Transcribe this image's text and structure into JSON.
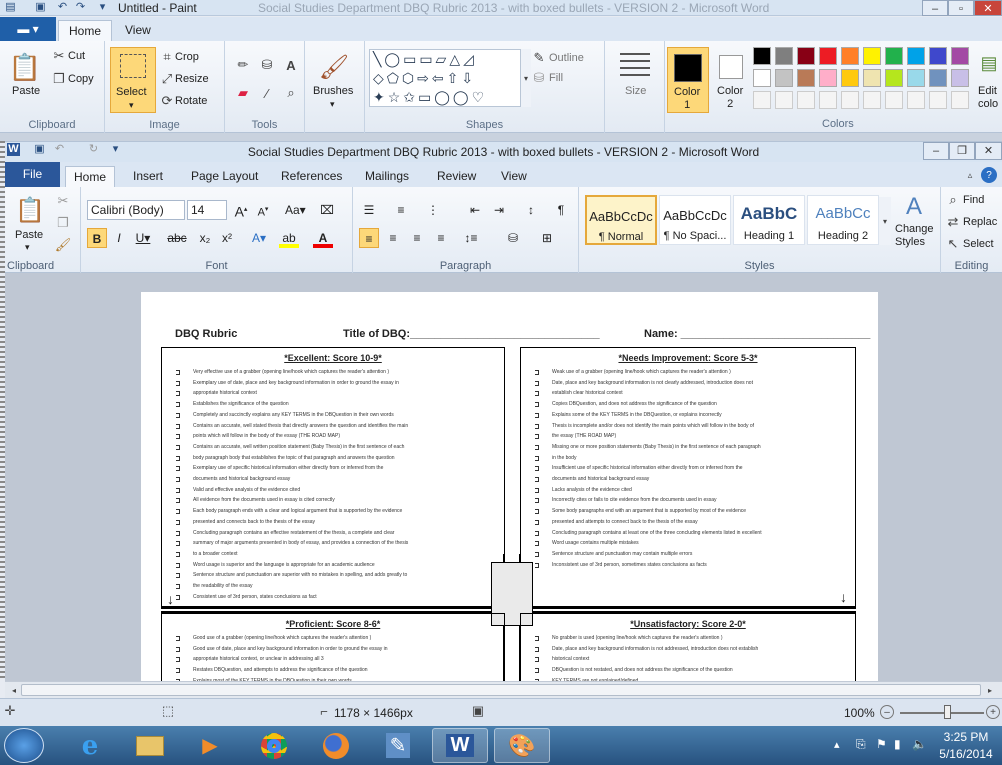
{
  "paint": {
    "title": "Untitled - Paint",
    "ghost_title": "Social Studies Department DBQ Rubric 2013 - with boxed bullets - VERSION 2 - Microsoft Word",
    "tabs": [
      "Home",
      "View"
    ],
    "clipboard": {
      "paste": "Paste",
      "cut": "Cut",
      "copy": "Copy",
      "label": "Clipboard"
    },
    "image": {
      "select": "Select",
      "crop": "Crop",
      "resize": "Resize",
      "rotate": "Rotate",
      "label": "Image"
    },
    "tools_label": "Tools",
    "brushes": "Brushes",
    "shapes_label": "Shapes",
    "outline": "Outline",
    "fill": "Fill",
    "size": "Size",
    "color1": "Color\n1",
    "color2": "Color\n2",
    "colors_label": "Colors",
    "edit": "Edit\ncolo",
    "palette": [
      "#000000",
      "#7f7f7f",
      "#880015",
      "#ed1c24",
      "#ff7f27",
      "#fff200",
      "#22b14c",
      "#00a2e8",
      "#3f48cc",
      "#a349a4",
      "#ffffff",
      "#c3c3c3",
      "#b97a57",
      "#ffaec9",
      "#ffc90e",
      "#efe4b0",
      "#b5e61d",
      "#99d9ea",
      "#7092be",
      "#c8bfe7"
    ]
  },
  "word": {
    "title": "Social Studies Department DBQ Rubric 2013 - with boxed bullets - VERSION 2  -  Microsoft Word",
    "tabs": [
      "File",
      "Home",
      "Insert",
      "Page Layout",
      "References",
      "Mailings",
      "Review",
      "View"
    ],
    "paste": "Paste",
    "clipboard_label": "Clipboard",
    "font_name": "Calibri (Body)",
    "font_size": "14",
    "font_label": "Font",
    "paragraph_label": "Paragraph",
    "styles": [
      {
        "preview": "AaBbCcDc",
        "name": "¶ Normal"
      },
      {
        "preview": "AaBbCcDc",
        "name": "¶ No Spaci..."
      },
      {
        "preview": "AaBbC",
        "name": "Heading 1"
      },
      {
        "preview": "AaBbCc",
        "name": "Heading 2"
      }
    ],
    "change_styles": "Change\nStyles",
    "styles_label": "Styles",
    "find": "Find",
    "replace": "Replac",
    "select": "Select",
    "editing_label": "Editing"
  },
  "doc": {
    "h_rubric": "DBQ Rubric",
    "h_title": "Title of DBQ:_______________________________",
    "h_name": "Name: _______________________________",
    "boxes": [
      {
        "title": "*Excellent:  Score 10-9*",
        "items": [
          "Very  effective  use of a grabber (opening line/hook which captures the reader's attention )",
          "Exemplary  use of date, place and key background information in order to ground the essay in",
          "appropriate  historical context",
          "Establishes the significance of the question",
          "Completely and succinctly explains any KEY TERMS in the DBQuestion in their own words",
          "Contains an accurate,  well stated thesis that directly answers the question and identifies the main",
          "points which will follow in the body of the essay (THE ROAD MAP)",
          "Contains an accurate,  well written position statement (Baby Thesis) in the first sentence of each",
          "body paragraph  body that establishes the topic of that paragraph  and answers the question",
          "Exemplary use of specific historical information either directly from or inferred from the",
          "documents and historical background essay",
          "Valid and effective analysis of the evidence cited",
          "All evidence from the documents used in essay is cited correctly",
          "Each body paragraph ends with a clear and logical argument that is supported by the evidence",
          "presented  and connects back to the thesis of the essay",
          "Concluding paragraph contains an effective restatement of the thesis, a complete and clear",
          "summary of major arguments presented  in body of essay, and provides a connection of the thesis",
          "to a broader context",
          "Word usage is superior and the language is appropriate for an academic audience",
          "Sentence structure and punctuation are superior with no mistakes in spelling, and adds greatly to",
          "the readability of the essay",
          "Consistent use of 3rd person, states conclusions as fact"
        ]
      },
      {
        "title": "*Needs Improvement: Score 5-3*",
        "items": [
          "Weak use of a grabber (opening line/hook which captures the reader's attention )",
          "Date, place and key background information is not clearly addressed, introduction does not",
          "establish clear historical context",
          "Copies DBQuestion, and does not address the significance of the question",
          "Explains some of the KEY TERMS in the DBQuestion, or explains incorrectly",
          "Thesis is incomplete and/or does not identify the main points which will follow in the body of",
          "the essay (THE ROAD MAP)",
          "Missing one or more position statements (Baby Thesis) in the first sentence of each paragraph",
          "in the body",
          "Insufficient use of specific historical information either directly from or inferred from the",
          "documents and historical background essay",
          "Lacks analysis of the evidence cited",
          "Incorrectly cites or fails to cite evidence from the documents used in essay",
          "Some body paragraphs end with an argument that is supported by most of the evidence",
          "presented and attempts to connect back to the thesis of the essay",
          "Concluding paragraph contains at least one of the three concluding elements listed in excellent",
          "Word usage contains multiple mistakes",
          "Sentence structure and punctuation may contain multiple errors",
          "Inconsistent use of 3rd person, sometimes states conclusions as facts"
        ]
      },
      {
        "title": "*Proficient:  Score  8-6*",
        "items": [
          "Good use of a grabber (opening line/hook which captures the reader's attention )",
          "Good use of date, place and key background information in order to ground the essay in",
          "appropriate historical context, or unclear in addressing all 3",
          "Restates DBQuestion, and attempts to address the significance of the question",
          "Explains most of the KEY TERMS in the DBQuestion in their own words"
        ]
      },
      {
        "title": "*Unsatisfactory: Score 2-0*",
        "items": [
          "No grabber is used (opening line/hook which captures the reader's attention )",
          "Date, place and key background information is not addressed, introduction does not establish",
          "historical context",
          "DBQuestion is not restated,  and does not address the significance of the question",
          "KEY TERMS are not explained/defined"
        ]
      }
    ]
  },
  "status": {
    "dimensions": "1178 × 1466px",
    "zoom": "100%"
  },
  "taskbar": {
    "time": "3:25 PM",
    "date": "5/16/2014"
  }
}
